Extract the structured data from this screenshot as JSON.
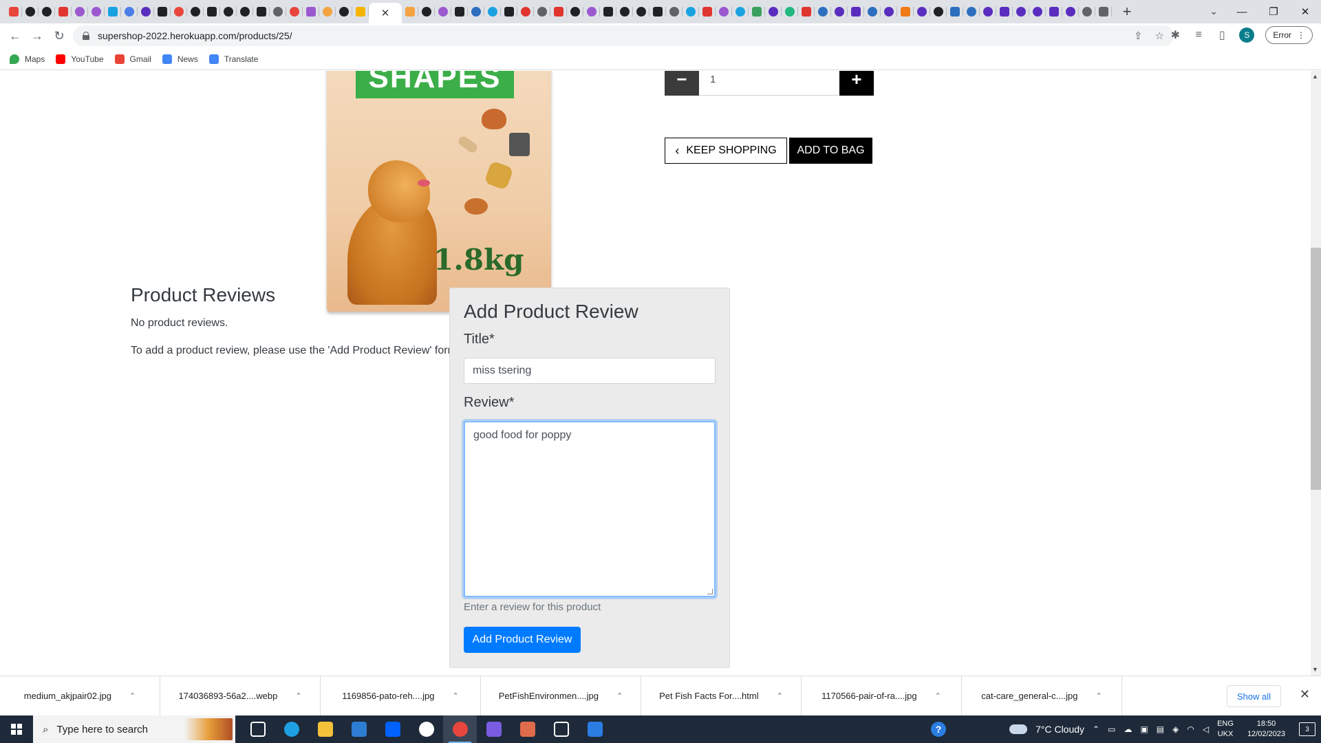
{
  "browser": {
    "favicons": [
      "#e8453c",
      "#202124",
      "#202124",
      "#e0342f",
      "#9b59d0",
      "#9b59d0",
      "#1aa2e0",
      "#4a7ee8",
      "#5a2dbf",
      "#202124",
      "#e8453c",
      "#202124",
      "#202124",
      "#202124",
      "#202124",
      "#202124",
      "#5f6368",
      "#e8453c",
      "#9b59d0",
      "#f4a340",
      "#202124",
      "#f4b400"
    ],
    "favicons_after": [
      "#f4a340",
      "#202124",
      "#9b59d0",
      "#202124",
      "#2d6fbf",
      "#1aa2e0",
      "#202124",
      "#e0342f",
      "#5f6368",
      "#e0342f",
      "#202124",
      "#9b59d0",
      "#202124",
      "#202124",
      "#202124",
      "#202124",
      "#5f6368",
      "#1aa2e0",
      "#e0342f",
      "#9b59d0",
      "#1aa2e0",
      "#3ba05b",
      "#5a2dbf",
      "#1fb980",
      "#e0342f",
      "#2d6fbf",
      "#5a2dbf",
      "#5a2dbf",
      "#2d6fbf",
      "#5a2dbf",
      "#f07b14",
      "#5a2dbf",
      "#202124",
      "#2d6fbf",
      "#2d6fbf",
      "#5a2dbf",
      "#5a2dbf",
      "#5a2dbf",
      "#5a2dbf",
      "#5a2dbf",
      "#5a2dbf",
      "#5f6368",
      "#5f6368"
    ],
    "active_tab_close": "✕",
    "new_tab": "+",
    "url": "supershop-2022.herokuapp.com/products/25/",
    "profile_initial": "S",
    "error_label": "Error",
    "window_controls": {
      "tab_search": "⌄",
      "minimize": "—",
      "maximize": "❐",
      "close": "✕"
    },
    "nav": {
      "back": "←",
      "forward": "→",
      "reload": "↻"
    }
  },
  "bookmarks": [
    {
      "label": "Maps",
      "color": "#34a853"
    },
    {
      "label": "YouTube",
      "color": "#ff0000"
    },
    {
      "label": "Gmail",
      "color": "#ea4335"
    },
    {
      "label": "News",
      "color": "#4285f4"
    },
    {
      "label": "Translate",
      "color": "#4285f4"
    }
  ],
  "product": {
    "image_alt": "Dog food bag",
    "bag_band_text": "SHAPES",
    "bag_weight": "1.8kg",
    "quantity": "1",
    "minus": "−",
    "plus": "+",
    "keep_shopping": "KEEP SHOPPING",
    "add_to_bag": "ADD TO BAG"
  },
  "reviews": {
    "title": "Product Reviews",
    "empty_message": "No product reviews.",
    "add_note": "To add a product review, please use the 'Add Product Review' form."
  },
  "review_form": {
    "heading": "Add Product Review",
    "title_label": "Title*",
    "title_value": "miss tsering",
    "review_label": "Review*",
    "review_value": "good food for poppy",
    "help_text": "Enter a review for this product",
    "submit_label": "Add Product Review"
  },
  "downloads": {
    "items": [
      "medium_akjpair02.jpg",
      "174036893-56a2....webp",
      "1169856-pato-reh....jpg",
      "PetFishEnvironmen....jpg",
      "Pet Fish Facts For....html",
      "1170566-pair-of-ra....jpg",
      "cat-care_general-c....jpg"
    ],
    "show_all": "Show all",
    "close": "✕"
  },
  "taskbar": {
    "search_placeholder": "Type here to search",
    "weather": "7°C  Cloudy",
    "lang_top": "ENG",
    "lang_bottom": "UKX",
    "time": "18:50",
    "date": "12/02/2023",
    "notifications": "3",
    "apps": [
      {
        "name": "task-view",
        "color": "#ffffff"
      },
      {
        "name": "edge",
        "color": "#1fa0e3"
      },
      {
        "name": "file-explorer",
        "color": "#f3c13a"
      },
      {
        "name": "mail",
        "color": "#2d7dd2"
      },
      {
        "name": "dropbox",
        "color": "#0061fe"
      },
      {
        "name": "github",
        "color": "#ffffff"
      },
      {
        "name": "chrome",
        "color": "#e8453c"
      },
      {
        "name": "vscode-like",
        "color": "#7a5ce0"
      },
      {
        "name": "paint",
        "color": "#e06c4c"
      },
      {
        "name": "settings",
        "color": "#ffffff"
      },
      {
        "name": "photos",
        "color": "#2a7de1"
      }
    ]
  },
  "colors": {
    "primary_button": "#007bff",
    "dark_button": "#000000",
    "form_card_bg": "#ebebeb"
  }
}
